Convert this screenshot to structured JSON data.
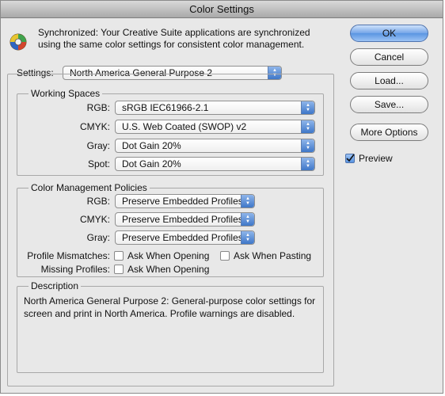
{
  "window": {
    "title": "Color Settings"
  },
  "sync": {
    "icon": "color-wheel-icon",
    "text": "Synchronized: Your Creative Suite applications are synchronized using the same color settings for consistent color management."
  },
  "settings": {
    "label": "Settings:",
    "value": "North America General Purpose 2"
  },
  "working_spaces": {
    "title": "Working Spaces",
    "rows": [
      {
        "label": "RGB:",
        "value": "sRGB IEC61966-2.1"
      },
      {
        "label": "CMYK:",
        "value": "U.S. Web Coated (SWOP) v2"
      },
      {
        "label": "Gray:",
        "value": "Dot Gain 20%"
      },
      {
        "label": "Spot:",
        "value": "Dot Gain 20%"
      }
    ]
  },
  "policies": {
    "title": "Color Management Policies",
    "rows": [
      {
        "label": "RGB:",
        "value": "Preserve Embedded Profiles"
      },
      {
        "label": "CMYK:",
        "value": "Preserve Embedded Profiles"
      },
      {
        "label": "Gray:",
        "value": "Preserve Embedded Profiles"
      }
    ],
    "mismatches_label": "Profile Mismatches:",
    "ask_opening": "Ask When Opening",
    "ask_pasting": "Ask When Pasting",
    "missing_label": "Missing Profiles:",
    "missing_ask_opening": "Ask When Opening"
  },
  "description": {
    "title": "Description",
    "text": "North America General Purpose 2:  General-purpose color settings for screen and print in North America. Profile warnings are disabled."
  },
  "buttons": {
    "ok": "OK",
    "cancel": "Cancel",
    "load": "Load...",
    "save": "Save...",
    "more_options": "More Options"
  },
  "preview": {
    "label": "Preview",
    "checked": true
  },
  "colors": {
    "accent": "#5a95e2",
    "window_bg": "#e8e8e8"
  }
}
